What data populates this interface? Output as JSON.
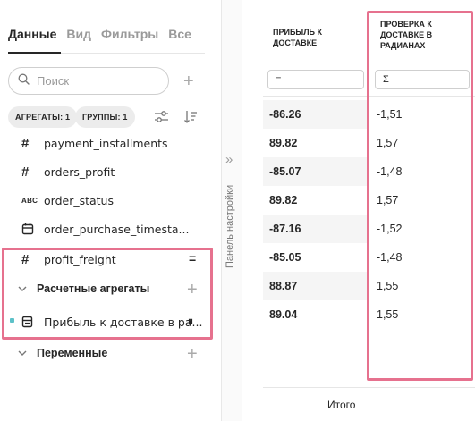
{
  "tabs": [
    "Данные",
    "Вид",
    "Фильтры",
    "Все"
  ],
  "search": {
    "placeholder": "Поиск"
  },
  "chips": {
    "aggregates": "АГРЕГАТЫ: 1",
    "groups": "ГРУППЫ: 1"
  },
  "fields": [
    {
      "icon": "#",
      "name": "payment_installments"
    },
    {
      "icon": "#",
      "name": "orders_profit"
    },
    {
      "icon": "ABC",
      "name": "order_status"
    },
    {
      "icon": "calendar",
      "name": "order_purchase_timesta..."
    },
    {
      "icon": "#",
      "name": "profit_freight",
      "tag": "="
    }
  ],
  "groups": {
    "calculated": {
      "label": "Расчетные агрегаты",
      "item": "Прибыль к доставке в ра...",
      "tag": "⏸"
    },
    "variables": {
      "label": "Переменные"
    }
  },
  "strip": {
    "label": "Панель настройки",
    "arrow": "»"
  },
  "table": {
    "col1_header": "ПРИБЫЛЬ К ДОСТАВКЕ",
    "col2_header": "ПРОВЕРКА К ДОСТАВКЕ В РАДИАНАХ",
    "col1_filter": "=",
    "col2_filter": "Σ",
    "rows": [
      {
        "profit": "-86.26",
        "radians": "-1,51"
      },
      {
        "profit": "89.82",
        "radians": "1,57"
      },
      {
        "profit": "-85.07",
        "radians": "-1,48"
      },
      {
        "profit": "89.82",
        "radians": "1,57"
      },
      {
        "profit": "-87.16",
        "radians": "-1,52"
      },
      {
        "profit": "-85.05",
        "radians": "-1,48"
      },
      {
        "profit": "88.87",
        "radians": "1,55"
      },
      {
        "profit": "89.04",
        "radians": "1,55"
      }
    ],
    "footer": "Итого"
  },
  "colors": {
    "highlight": "#e6718e",
    "accent_dot": "#5cc1c8",
    "stripe": "#f5f5f5"
  }
}
